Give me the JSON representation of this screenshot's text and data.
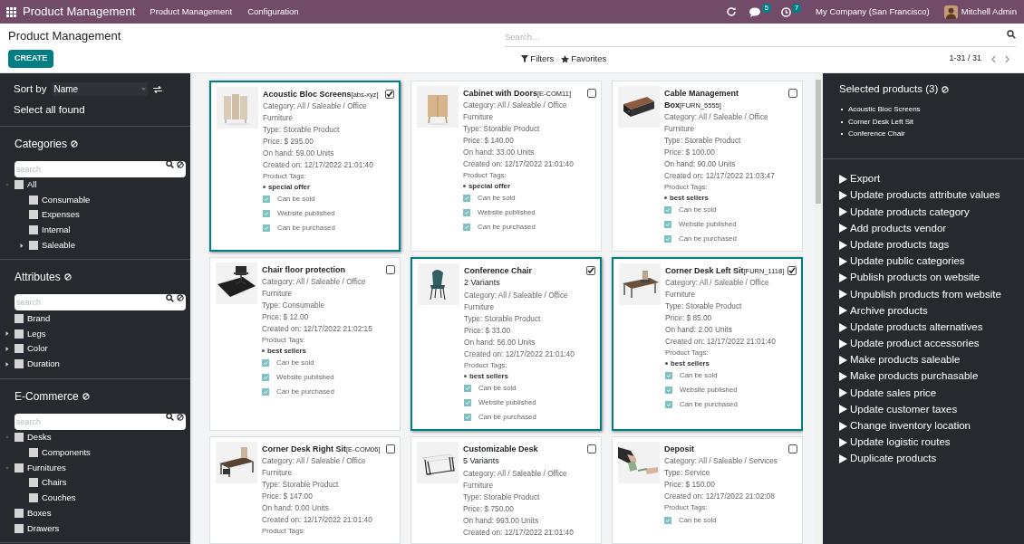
{
  "top_bar": {
    "app_name": "Product Management",
    "menu": [
      "Product Management",
      "Configuration"
    ],
    "chat_badge": "5",
    "activity_badge": "7",
    "company": "My Company (San Francisco)",
    "user": "Mitchell Admin"
  },
  "control_panel": {
    "breadcrumb": "Product Management",
    "search_placeholder": "Search...",
    "create_button": "CREATE",
    "filters": "Filters",
    "favorites": "Favorites",
    "pager": "1-31 / 31"
  },
  "sidebar": {
    "sort_label": "Sort by",
    "sort_value": "Name",
    "select_all": "Select all found",
    "sections": [
      {
        "title": "Categories",
        "search_placeholder": "search",
        "items": [
          {
            "label": "All",
            "checked": false,
            "expanded": true,
            "children": [
              {
                "label": "Consumable",
                "checked": false
              },
              {
                "label": "Expenses",
                "checked": false
              },
              {
                "label": "Internal",
                "checked": false
              },
              {
                "label": "Saleable",
                "checked": false,
                "expanded": false
              }
            ]
          }
        ]
      },
      {
        "title": "Attributes",
        "search_placeholder": "search",
        "items": [
          {
            "label": "Brand",
            "checked": false
          },
          {
            "label": "Legs",
            "checked": false,
            "expanded": false
          },
          {
            "label": "Color",
            "checked": false,
            "expanded": false
          },
          {
            "label": "Duration",
            "checked": false,
            "expanded": false
          }
        ]
      },
      {
        "title": "E-Commerce",
        "search_placeholder": "search",
        "items": [
          {
            "label": "Desks",
            "checked": false,
            "expanded": true,
            "children": [
              {
                "label": "Components",
                "checked": false
              }
            ]
          },
          {
            "label": "Furnitures",
            "checked": false,
            "expanded": true,
            "children": [
              {
                "label": "Chairs",
                "checked": false
              },
              {
                "label": "Couches",
                "checked": false
              }
            ]
          },
          {
            "label": "Boxes",
            "checked": false
          },
          {
            "label": "Drawers",
            "checked": false
          }
        ]
      }
    ]
  },
  "products": [
    {
      "name": "Acoustic Bloc Screens",
      "code": "[abs-xyz]",
      "selected": true,
      "details": [
        "Category: All / Saleable / Office Furniture",
        "Type: Storable Product",
        "Price: $ 295.00",
        "On hand: 59.00 Units",
        "Created on: 12/17/2022 21:01:40"
      ],
      "tags_label": "Product Tags:",
      "tags": [
        "special offer"
      ],
      "flags": [
        {
          "label": "Can be sold",
          "checked": true
        },
        {
          "label": "Website published",
          "checked": true
        },
        {
          "label": "Can be purchased",
          "checked": true
        }
      ]
    },
    {
      "name": "Cabinet with Doors",
      "code": "[E-COM11]",
      "selected": false,
      "details": [
        "Category: All / Saleable / Office Furniture",
        "Type: Storable Product",
        "Price: $ 140.00",
        "On hand: 33.00 Units",
        "Created on: 12/17/2022 21:01:40"
      ],
      "tags_label": "Product Tags:",
      "tags": [
        "special offer"
      ],
      "flags": [
        {
          "label": "Can be sold",
          "checked": true
        },
        {
          "label": "Website published",
          "checked": true
        },
        {
          "label": "Can be purchased",
          "checked": true
        }
      ]
    },
    {
      "name": "Cable Management Box",
      "code": "[FURN_5555]",
      "selected": false,
      "details": [
        "Category: All / Saleable / Office Furniture",
        "Type: Storable Product",
        "Price: $ 100.00",
        "On hand: 90.00 Units",
        "Created on: 12/17/2022 21:03:47"
      ],
      "tags_label": "Product Tags:",
      "tags": [
        "best sellers"
      ],
      "flags": [
        {
          "label": "Can be sold",
          "checked": true
        },
        {
          "label": "Website published",
          "checked": true
        },
        {
          "label": "Can be purchased",
          "checked": true
        }
      ]
    },
    {
      "name": "Chair floor protection",
      "selected": false,
      "details": [
        "Category: All / Saleable / Office Furniture",
        "Type: Consumable",
        "Price: $ 12.00",
        "Created on: 12/17/2022 21:02:15"
      ],
      "tags_label": "Product Tags:",
      "tags": [
        "best sellers"
      ],
      "flags": [
        {
          "label": "Can be sold",
          "checked": true
        },
        {
          "label": "Website published",
          "checked": true
        },
        {
          "label": "Can be purchased",
          "checked": true
        }
      ]
    },
    {
      "name": "Conference Chair",
      "variants": "2 Variants",
      "selected": true,
      "details": [
        "Category: All / Saleable / Office Furniture",
        "Type: Storable Product",
        "Price: $ 33.00",
        "On hand: 56.00 Units",
        "Created on: 12/17/2022 21:01:40"
      ],
      "tags_label": "Product Tags:",
      "tags": [
        "best sellers"
      ],
      "flags": [
        {
          "label": "Can be sold",
          "checked": true
        },
        {
          "label": "Website published",
          "checked": true
        },
        {
          "label": "Can be purchased",
          "checked": true
        }
      ]
    },
    {
      "name": "Corner Desk Left Sit",
      "code": "[FURN_1118]",
      "selected": true,
      "details": [
        "Category: All / Saleable / Office Furniture",
        "Type: Storable Product",
        "Price: $ 85.00",
        "On hand: 2.00 Units",
        "Created on: 12/17/2022 21:01:40"
      ],
      "tags_label": "Product Tags:",
      "tags": [
        "best sellers"
      ],
      "flags": [
        {
          "label": "Can be sold",
          "checked": true
        },
        {
          "label": "Website published",
          "checked": true
        },
        {
          "label": "Can be purchased",
          "checked": true
        }
      ]
    },
    {
      "name": "Corner Desk Right Sit",
      "code": "[E-COM06]",
      "selected": false,
      "details": [
        "Category: All / Saleable / Office Furniture",
        "Type: Storable Product",
        "Price: $ 147.00",
        "On hand: 0.00 Units",
        "Created on: 12/17/2022 21:01:40"
      ],
      "tags_label": "Product Tags:"
    },
    {
      "name": "Customizable Desk",
      "variants": "5 Variants",
      "selected": false,
      "details": [
        "Category: All / Saleable / Office Furniture",
        "Type: Storable Product",
        "Price: $ 750.00",
        "On hand: 993.00 Units",
        "Created on: 12/17/2022 21:01:40"
      ]
    },
    {
      "name": "Deposit",
      "selected": false,
      "details": [
        "Category: All / Saleable / Services",
        "Type: Service",
        "Price: $ 150.00",
        "Created on: 12/17/2022 21:02:08"
      ],
      "tags_label": "Product Tags:",
      "flags": [
        {
          "label": "Can be sold",
          "checked": true
        }
      ]
    }
  ],
  "selection_panel": {
    "title": "Selected products (3)",
    "selected": [
      "Acoustic Bloc Screens",
      "Corner Desk Left Sit",
      "Conference Chair"
    ],
    "actions": [
      "Export",
      "Update products attribute values",
      "Update products category",
      "Add products vendor",
      "Update products tags",
      "Update public categories",
      "Publish products on website",
      "Unpublish products from website",
      "Archive products",
      "Update products alternatives",
      "Update product accessories",
      "Make products saleable",
      "Make products purchasable",
      "Update sales price",
      "Update customer taxes",
      "Change inventory location",
      "Update logistic routes",
      "Duplicate products"
    ]
  }
}
